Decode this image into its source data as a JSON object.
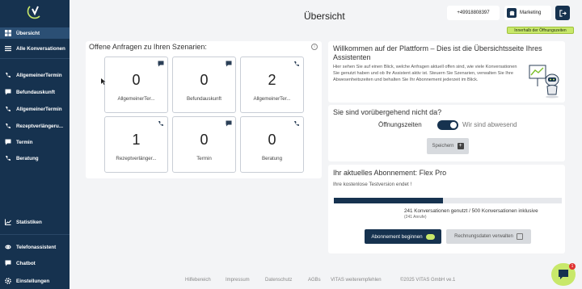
{
  "header": {
    "page_title": "Übersicht",
    "phone": "+49918808397",
    "account": "Marketing",
    "hours_badge": "Innerhalb der Öffnungszeiten"
  },
  "sidebar": {
    "items": [
      {
        "label": "Übersicht",
        "icon": "dashboard-icon",
        "active": true
      },
      {
        "label": "Alle Konversationen",
        "icon": "list-icon"
      },
      {
        "label": "AllgemeinerTermin",
        "icon": "phone-icon"
      },
      {
        "label": "Befundauskunft",
        "icon": "chat-icon"
      },
      {
        "label": "AllgemeinerTermin",
        "icon": "phone-icon"
      },
      {
        "label": "Rezeptverlängeru...",
        "icon": "phone-icon"
      },
      {
        "label": "Termin",
        "icon": "chat-icon"
      },
      {
        "label": "Beratung",
        "icon": "phone-icon"
      },
      {
        "label": "Statistiken",
        "icon": "chart-icon"
      },
      {
        "label": "Telefonassistent",
        "icon": "headset-icon"
      },
      {
        "label": "Chatbot",
        "icon": "chat-icon"
      },
      {
        "label": "Einstellungen",
        "icon": "gear-icon"
      }
    ]
  },
  "requests": {
    "title": "Offene Anfragen zu Ihren Szenarien:",
    "info": "i",
    "tiles": [
      {
        "count": "0",
        "label": "AllgemeinerTer...",
        "icon": "chat-icon"
      },
      {
        "count": "0",
        "label": "Befundauskunft",
        "icon": "chat-icon"
      },
      {
        "count": "2",
        "label": "AllgemeinerTer...",
        "icon": "phone-icon"
      },
      {
        "count": "1",
        "label": "Rezeptverlänger...",
        "icon": "phone-icon"
      },
      {
        "count": "0",
        "label": "Termin",
        "icon": "chat-icon"
      },
      {
        "count": "0",
        "label": "Beratung",
        "icon": "phone-icon"
      }
    ]
  },
  "welcome": {
    "title": "Willkommen auf der Plattform – Dies ist die Übersichtsseite Ihres Assistenten",
    "text": "Hier sehen Sie auf einen Blick, welche Anfragen aktuell offen sind, wie viele Konversationen Sie genutzt haben und ob Ihr Assistent aktiv ist. Steuern Sie Szenarien, verwalten Sie Ihre Abwesenheitszeiten und behalten Sie Ihr Abonnement jederzeit im Blick."
  },
  "absent": {
    "title": "Sie sind vorübergehend nicht da?",
    "left_label": "Öffnungszeiten",
    "right_label": "Wir sind abwesend",
    "save_label": "Speichern",
    "save_icon": "+"
  },
  "subscription": {
    "title": "Ihr aktuelles Abonnement: Flex Pro",
    "subtitle": "Ihre kostenlose Testversion endet !",
    "progress": 0.48,
    "usage": "241 Konversationen genutzt / 500 Konversationen inklusive",
    "usage_sub": "(241 Anrufe)",
    "primary_label": "Abonnement beginnen",
    "secondary_label": "Rechnungsdaten verwalten"
  },
  "footer": {
    "links": [
      "Hilfebereich",
      "Impressum",
      "Datenschutz",
      "AGBs",
      "VITAS weiterempfehlen",
      "©2025 VITAS GmbH ve.1"
    ]
  },
  "chat": {
    "badge": "1"
  },
  "colors": {
    "brand": "#16324f",
    "accent": "#c8e86a"
  }
}
